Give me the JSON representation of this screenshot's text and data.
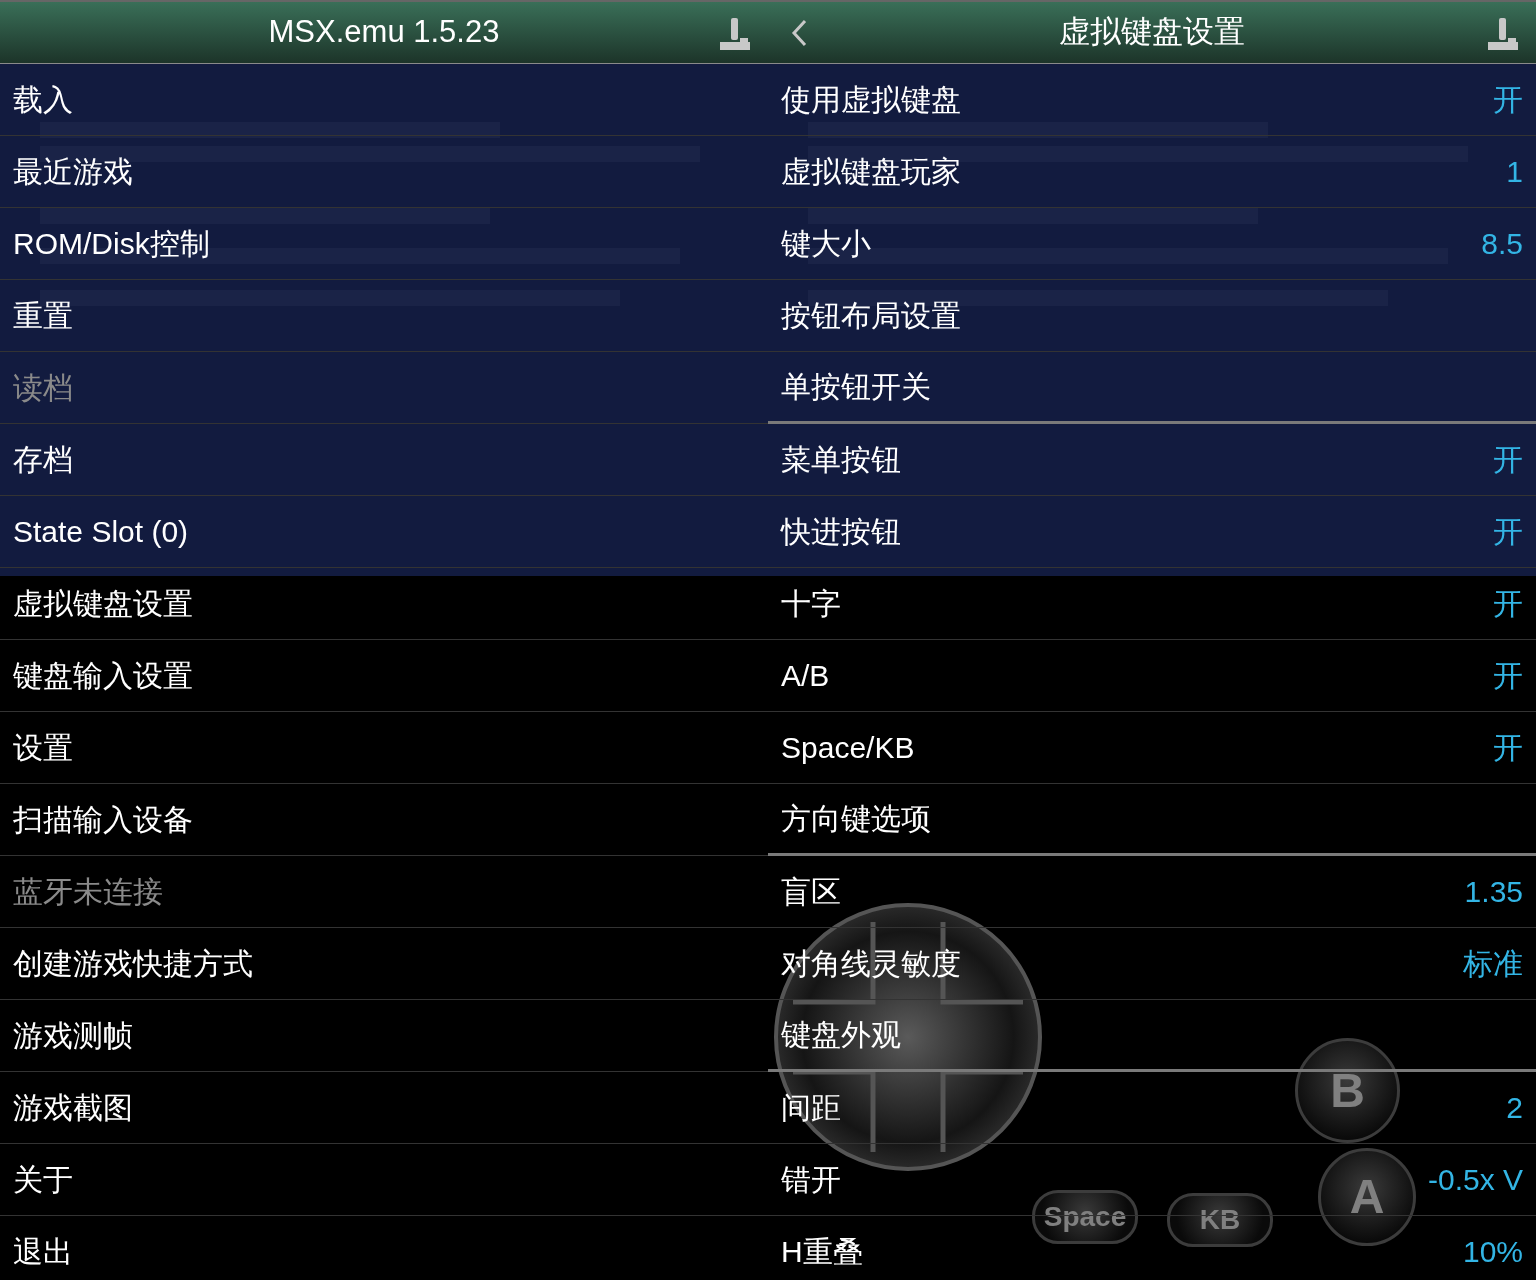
{
  "header": {
    "left": {
      "title": "MSX.emu 1.5.23"
    },
    "right": {
      "title": "虚拟键盘设置"
    }
  },
  "main_menu": [
    {
      "label": "载入",
      "disabled": false
    },
    {
      "label": "最近游戏",
      "disabled": false
    },
    {
      "label": "ROM/Disk控制",
      "disabled": false
    },
    {
      "label": "重置",
      "disabled": false
    },
    {
      "label": "读档",
      "disabled": true
    },
    {
      "label": "存档",
      "disabled": false
    },
    {
      "label": "State Slot (0)",
      "disabled": false
    },
    {
      "label": "虚拟键盘设置",
      "disabled": false
    },
    {
      "label": "键盘输入设置",
      "disabled": false
    },
    {
      "label": "设置",
      "disabled": false
    },
    {
      "label": "扫描输入设备",
      "disabled": false
    },
    {
      "label": "蓝牙未连接",
      "disabled": true
    },
    {
      "label": "创建游戏快捷方式",
      "disabled": false
    },
    {
      "label": "游戏测帧",
      "disabled": false
    },
    {
      "label": "游戏截图",
      "disabled": false
    },
    {
      "label": "关于",
      "disabled": false
    },
    {
      "label": "退出",
      "disabled": false
    }
  ],
  "keyboard_settings": [
    {
      "label": "使用虚拟键盘",
      "value": "开",
      "kind": "item"
    },
    {
      "label": "虚拟键盘玩家",
      "value": "1",
      "kind": "item"
    },
    {
      "label": "键大小",
      "value": "8.5",
      "kind": "item"
    },
    {
      "label": "按钮布局设置",
      "kind": "item"
    },
    {
      "label": "单按钮开关",
      "kind": "group-end"
    },
    {
      "label": "菜单按钮",
      "value": "开",
      "kind": "item"
    },
    {
      "label": "快进按钮",
      "value": "开",
      "kind": "item"
    },
    {
      "label": "十字",
      "value": "开",
      "kind": "item"
    },
    {
      "label": "A/B",
      "value": "开",
      "kind": "item"
    },
    {
      "label": "Space/KB",
      "value": "开",
      "kind": "item"
    },
    {
      "label": "方向键选项",
      "kind": "group-end"
    },
    {
      "label": "盲区",
      "value": "1.35",
      "kind": "item"
    },
    {
      "label": "对角线灵敏度",
      "value": "标准",
      "kind": "item"
    },
    {
      "label": "键盘外观",
      "kind": "group-end"
    },
    {
      "label": "间距",
      "value": "2",
      "kind": "item"
    },
    {
      "label": "错开",
      "value": "-0.5x V",
      "kind": "item"
    },
    {
      "label": "H重叠",
      "value": "10%",
      "kind": "item"
    }
  ],
  "gamepad_overlay": {
    "buttons": [
      {
        "label": "B",
        "kind": "round"
      },
      {
        "label": "A",
        "kind": "round"
      },
      {
        "label": "Space",
        "kind": "pill"
      },
      {
        "label": "KB",
        "kind": "pill"
      }
    ]
  }
}
